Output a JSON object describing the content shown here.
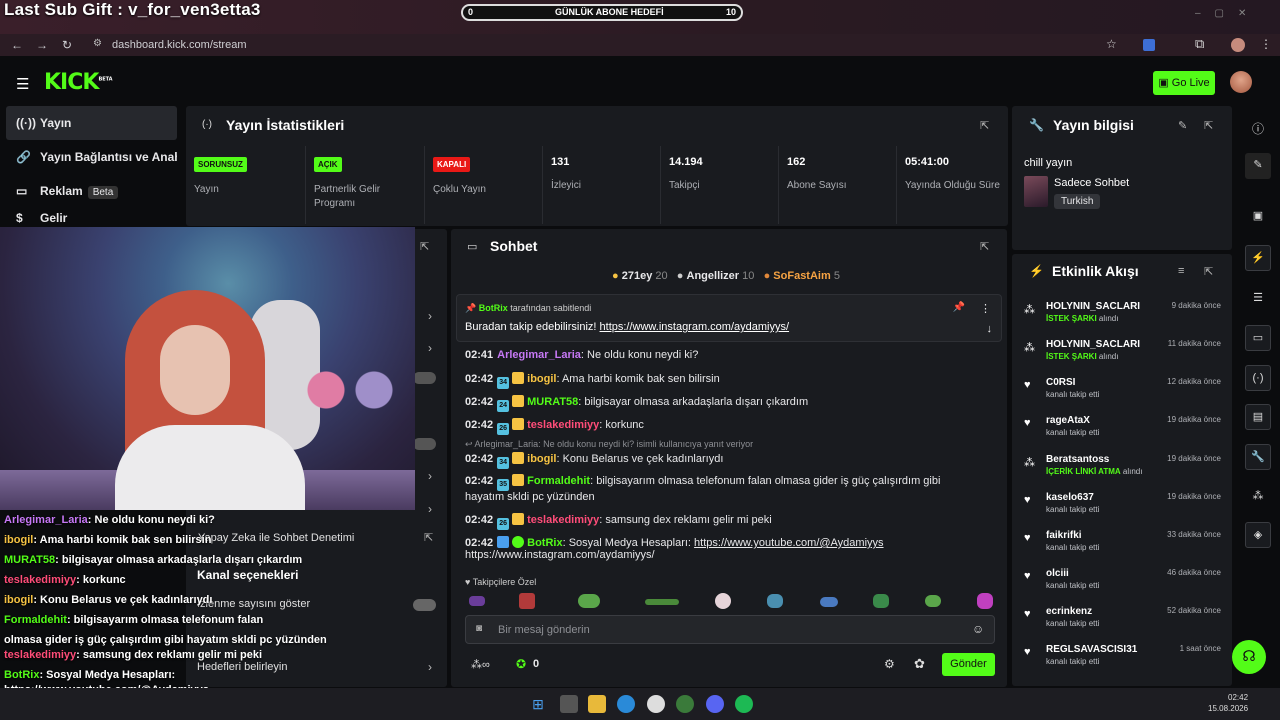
{
  "overlay": {
    "sub_gift": "Last Sub Gift : v_for_ven3etta3",
    "goal": {
      "min": "0",
      "label": "GÜNLÜK ABONE HEDEFİ",
      "max": "10"
    }
  },
  "browser": {
    "url": "dashboard.kick.com/stream"
  },
  "header": {
    "logo": "KICK",
    "logo_tag": "BETA",
    "go_live": "Go Live"
  },
  "nav": {
    "items": [
      {
        "label": "Yayın",
        "icon": "broadcast-icon"
      },
      {
        "label": "Yayın Bağlantısı ve Anahtar",
        "icon": "link-icon"
      },
      {
        "label": "Reklam",
        "badge": "Beta",
        "icon": "ad-icon"
      },
      {
        "label": "Gelir",
        "icon": "dollar-icon"
      }
    ]
  },
  "stats": {
    "title": "Yayın İstatistikleri",
    "items": [
      {
        "badge": "SORUNSUZ",
        "label": "Yayın",
        "color": "#53fc18"
      },
      {
        "badge": "AÇIK",
        "label": "Partnerlik Gelir Programı",
        "color": "#53fc18"
      },
      {
        "badge": "KAPALI",
        "label": "Çoklu Yayın",
        "color": "#e91916"
      },
      {
        "value": "131",
        "label": "İzleyici"
      },
      {
        "value": "14.194",
        "label": "Takipçi"
      },
      {
        "value": "162",
        "label": "Abone Sayısı"
      },
      {
        "value": "05:41:00",
        "label": "Yayında Olduğu Süre"
      }
    ]
  },
  "stream_info": {
    "title": "Yayın bilgisi",
    "stream_title": "chill yayın",
    "category": "Sadece Sohbet",
    "tag": "Turkish"
  },
  "chat": {
    "title": "Sohbet",
    "leaders": [
      {
        "name": "271ey",
        "count": "20"
      },
      {
        "name": "Angellizer",
        "count": "10"
      },
      {
        "name": "SoFastAim",
        "count": "5"
      }
    ],
    "pinned": {
      "by": "BotRix",
      "by_suffix": "tarafından sabitlendi",
      "text": "Buradan takip edebilirsiniz! ",
      "link": "https://www.instagram.com/aydamiyys/"
    },
    "reply_hint": "Arlegimar_Laria: Ne oldu konu neydi ki? isimli kullanıcıya yanıt veriyor",
    "messages": [
      {
        "time": "02:41",
        "user": "Arlegimar_Laria",
        "text": ": Ne oldu konu neydi ki?",
        "color": "#c678f5"
      },
      {
        "time": "02:42",
        "user": "ibogil",
        "text": ": Ama harbi komik bak sen bilirsin",
        "color": "#f6c343",
        "b1": "34"
      },
      {
        "time": "02:42",
        "user": "MURAT58",
        "text": ": bilgisayar olmasa arkadaşlarla dışarı çıkardım",
        "color": "#53fc18",
        "b1": "24"
      },
      {
        "time": "02:42",
        "user": "teslakedimiyy",
        "text": ": korkunc",
        "color": "#ff4d79",
        "b1": "26"
      },
      {
        "time": "02:42",
        "user": "ibogil",
        "text": ": Konu Belarus ve çek kadınlarıydı",
        "color": "#f6c343",
        "b1": "34"
      },
      {
        "time": "02:42",
        "user": "Formaldehit",
        "text": ": bilgisayarım olmasa telefonum falan olmasa gider iş güç çalışırdım gibi",
        "text2": "hayatım skldi pc yüzünden",
        "color": "#53fc18",
        "b1": "35"
      },
      {
        "time": "02:42",
        "user": "teslakedimiyy",
        "text": ": samsung dex reklamı gelir mi peki",
        "color": "#ff4d79",
        "b1": "26"
      },
      {
        "time": "02:42",
        "user": "BotRix",
        "text": ": Sosyal Medya Hesapları: ",
        "link": "https://www.youtube.com/@Aydamiyys",
        "text2": "https://www.instagram.com/aydamiyys/",
        "color": "#53fc18"
      }
    ],
    "emote_label": "Takipçilere Özel",
    "input_placeholder": "Bir mesaj gönderin",
    "points": "0",
    "send": "Gönder"
  },
  "activity": {
    "title": "Etkinlik Akışı",
    "items": [
      {
        "user": "HOLYNIN_SACLARI",
        "highlight": "İSTEK ŞARKI",
        "action": " alındı",
        "time": "9 dakika önce",
        "icon": "redeem-icon"
      },
      {
        "user": "HOLYNIN_SACLARI",
        "highlight": "İSTEK ŞARKI",
        "action": " alındı",
        "time": "11 dakika önce",
        "icon": "redeem-icon"
      },
      {
        "user": "C0RSI",
        "action": "kanalı takip etti",
        "time": "12 dakika önce",
        "icon": "heart-icon"
      },
      {
        "user": "rageAtaX",
        "action": "kanalı takip etti",
        "time": "19 dakika önce",
        "icon": "heart-icon"
      },
      {
        "user": "Beratsantoss",
        "highlight": "İÇERİK LİNKİ ATMA",
        "action": " alındı",
        "time": "19 dakika önce",
        "icon": "redeem-icon"
      },
      {
        "user": "kaselo637",
        "action": "kanalı takip etti",
        "time": "19 dakika önce",
        "icon": "heart-icon"
      },
      {
        "user": "faikrifki",
        "action": "kanalı takip etti",
        "time": "33 dakika önce",
        "icon": "heart-icon"
      },
      {
        "user": "olciii",
        "action": "kanalı takip etti",
        "time": "46 dakika önce",
        "icon": "heart-icon"
      },
      {
        "user": "ecrinkenz",
        "action": "kanalı takip etti",
        "time": "52 dakika önce",
        "icon": "heart-icon"
      },
      {
        "user": "REGLSAVASCISI31",
        "action": "kanalı takip etti",
        "time": "1 saat önce",
        "icon": "heart-icon"
      }
    ]
  },
  "settings_behind": {
    "ai_moderation": "Yapay Zeka ile Sohbet Denetimi",
    "channel_options": "Kanal seçenekleri",
    "show_viewcount": "İzlenme sayısını göster",
    "goals": "Hedefleri belirleyin"
  },
  "overlay_chat": [
    {
      "user": "Arlegimar_Laria",
      "text": " Ne oldu konu neydi ki?",
      "color": "#c678f5"
    },
    {
      "user": "ibogil",
      "text": " Ama harbi komik bak sen bilirsin",
      "color": "#f6c343"
    },
    {
      "user": "MURAT58",
      "text": " bilgisayar olmasa arkadaşlarla dışarı çıkardım",
      "color": "#53fc18"
    },
    {
      "user": "teslakedimiyy",
      "text": " korkunc",
      "color": "#ff4d79"
    },
    {
      "user": "ibogil",
      "text": " Konu Belarus ve çek kadınlarıydı",
      "color": "#f6c343"
    },
    {
      "user": "Formaldehit",
      "text": " bilgisayarım olmasa telefonum falan",
      "color": "#53fc18",
      "text2": "olmasa gider iş güç çalışırdım gibi hayatım skldi pc yüzünden"
    },
    {
      "user": "teslakedimiyy",
      "text": " samsung dex reklamı gelir mi peki",
      "color": "#ff4d79"
    },
    {
      "user": "BotRix",
      "text": " Sosyal Medya Hesapları:",
      "color": "#53fc18",
      "text2": "https://www.youtube.com/@Aydamiyys",
      "text3": "https://www.instagram.com/aydamiyys/"
    }
  ],
  "taskbar": {
    "time": "02:42",
    "date": "15.08.2026"
  }
}
